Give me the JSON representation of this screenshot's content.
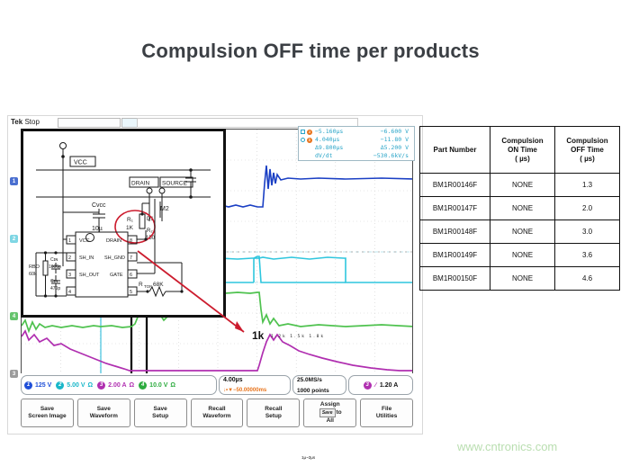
{
  "page": {
    "title": "Compulsion OFF time per products",
    "watermark": "www.cntronics.com"
  },
  "scope": {
    "brand": "Tek",
    "run_state": "Stop",
    "cursor_readout": {
      "rows": [
        {
          "marker": "square",
          "time": "−5.160µs",
          "volts": "−6.600 V"
        },
        {
          "marker": "circle",
          "time": "4.040µs",
          "volts": "−11.80 V"
        },
        {
          "marker": "delta",
          "time": "Δ9.800µs",
          "volts": "Δ5.200 V"
        },
        {
          "marker": "rate",
          "time": "dV/dt",
          "volts": "−530.6kV/s"
        }
      ]
    },
    "annotations": {
      "callout_1k": "1k",
      "mini_labels": "1.2k 1.5k 1.8k",
      "pulse_width": "1µ~2µs"
    },
    "channels": [
      {
        "id": "1",
        "label": "125 V",
        "color": "#1f4fd8",
        "coupling": ""
      },
      {
        "id": "2",
        "label": "5.00 V",
        "color": "#19b7c9",
        "coupling": "Ω"
      },
      {
        "id": "3",
        "label": "2.00 A",
        "color": "#b02fb0",
        "coupling": "Ω"
      },
      {
        "id": "4",
        "label": "10.0 V",
        "color": "#2cab3e",
        "coupling": "Ω"
      }
    ],
    "timebase": {
      "scale": "4.00µs",
      "position": "↓•▼−50.00000ms"
    },
    "acquisition": {
      "sample_rate": "25.0MS/s",
      "record_length": "1000 points"
    },
    "trigger": {
      "source": "3",
      "slope": "∕",
      "level": "1.20 A"
    },
    "menu_buttons": [
      {
        "line1": "Save",
        "line2": "Screen Image"
      },
      {
        "line1": "Save",
        "line2": "Waveform"
      },
      {
        "line1": "Save",
        "line2": "Setup"
      },
      {
        "line1": "Recall",
        "line2": "Waveform"
      },
      {
        "line1": "Recall",
        "line2": "Setup"
      },
      {
        "line1": "Assign",
        "chip": "Save",
        "line2": "to",
        "line3": "All"
      },
      {
        "line1": "File",
        "line2": "Utilities"
      }
    ]
  },
  "schematic": {
    "labels": {
      "vcc": "VCC",
      "drain": "DRAIN",
      "source": "SOURCE",
      "cvcc": "Cvcc",
      "cvcc_val": "10µ",
      "r1": "R₁",
      "r1_val": "1K",
      "d1": "D1",
      "r2": "R₂",
      "r2_val": "150",
      "m2": "M2",
      "pin1": "VCC",
      "pin2": "SH_IN",
      "pin3": "SH_OUT",
      "pin8": "DRAIN",
      "pin7": "SH_GND",
      "pin6": "GATE",
      "rton": "Rₜₒₙ 68K",
      "rbo": "RBO 60k",
      "cin1": "Cₗₙ 1000p",
      "cin2": "Cₗₙ 470p"
    }
  },
  "table": {
    "headers": [
      "Part Number",
      "Compulsion\nON Time\n( µs)",
      "Compulsion\nOFF Time\n( µs)"
    ],
    "header_parts": {
      "h1": "Part Number",
      "h2_l1": "Compulsion",
      "h2_l2": "ON Time",
      "h2_l3": "( µs)",
      "h3_l1": "Compulsion",
      "h3_l2": "OFF Time",
      "h3_l3": "( µs)"
    },
    "rows": [
      {
        "part": "BM1R00146F",
        "on": "NONE",
        "off": "1.3"
      },
      {
        "part": "BM1R00147F",
        "on": "NONE",
        "off": "2.0"
      },
      {
        "part": "BM1R00148F",
        "on": "NONE",
        "off": "3.0"
      },
      {
        "part": "BM1R00149F",
        "on": "NONE",
        "off": "3.6"
      },
      {
        "part": "BM1R00150F",
        "on": "NONE",
        "off": "4.6"
      }
    ]
  }
}
